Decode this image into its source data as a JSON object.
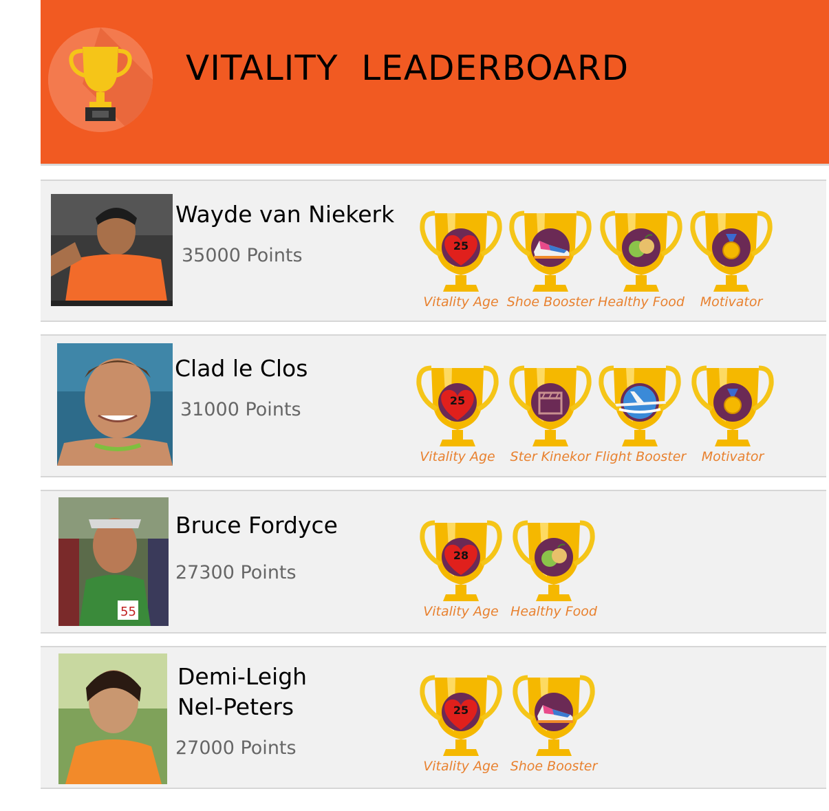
{
  "header": {
    "title": "VITALITY  LEADERBOARD",
    "background": "#F15A22",
    "logo_icon": "trophy-icon"
  },
  "leaderboard": [
    {
      "name": "Wayde van Niekerk",
      "points": "35000 Points",
      "photo_icon": "athlete-photo",
      "badges": [
        {
          "label": "Vitality Age",
          "icon": "heart-icon",
          "value": "25"
        },
        {
          "label": "Shoe Booster",
          "icon": "shoe-icon"
        },
        {
          "label": "Healthy Food",
          "icon": "apple-icon"
        },
        {
          "label": "Motivator",
          "icon": "medal-icon"
        }
      ]
    },
    {
      "name": "Clad le Clos",
      "points": "31000 Points",
      "photo_icon": "athlete-photo",
      "badges": [
        {
          "label": "Vitality Age",
          "icon": "heart-icon",
          "value": "25"
        },
        {
          "label": "Ster Kinekor",
          "icon": "clapperboard-icon"
        },
        {
          "label": "Flight Booster",
          "icon": "airplane-icon"
        },
        {
          "label": "Motivator",
          "icon": "medal-icon"
        }
      ]
    },
    {
      "name": "Bruce Fordyce",
      "points": "27300 Points",
      "photo_icon": "athlete-photo",
      "badges": [
        {
          "label": "Vitality Age",
          "icon": "heart-icon",
          "value": "28"
        },
        {
          "label": "Healthy Food",
          "icon": "apple-icon"
        }
      ]
    },
    {
      "name_line1": "Demi-Leigh",
      "name_line2": "Nel-Peters",
      "points": "27000 Points",
      "photo_icon": "athlete-photo",
      "badges": [
        {
          "label": "Vitality Age",
          "icon": "heart-icon",
          "value": "25"
        },
        {
          "label": "Shoe Booster",
          "icon": "shoe-icon"
        }
      ]
    }
  ],
  "colors": {
    "accent": "#F15A22",
    "badge_label": "#E8812F",
    "trophy_gold": "#F5B800",
    "badge_disc": "#6B2A55",
    "points_text": "#666666"
  }
}
